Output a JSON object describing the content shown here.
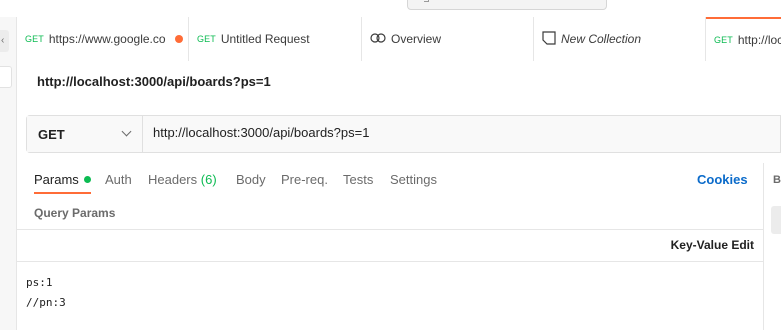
{
  "tabs": [
    {
      "method": "GET",
      "label": "https://www.google.co",
      "unsaved": true
    },
    {
      "method": "GET",
      "label": "Untitled Request"
    },
    {
      "icon": "overview-icon",
      "label": "Overview"
    },
    {
      "icon": "collection-icon",
      "label": "New Collection"
    },
    {
      "method": "GET",
      "label": "http://loc"
    }
  ],
  "request": {
    "title": "http://localhost:3000/api/boards?ps=1",
    "method": "GET",
    "url": "http://localhost:3000/api/boards?ps=1"
  },
  "request_tabs": {
    "params": "Params",
    "auth": "Auth",
    "headers": "Headers",
    "headers_count": "(6)",
    "body": "Body",
    "prereq": "Pre-req.",
    "tests": "Tests",
    "settings": "Settings",
    "cookies": "Cookies"
  },
  "params": {
    "section_label": "Query Params",
    "mode_toggle": "Key-Value Edit",
    "bulk_lines": [
      "ps:1",
      "//pn:3"
    ]
  },
  "right_panel": {
    "letter": "B"
  },
  "colors": {
    "accent": "#ff6c37",
    "get": "#0cbb52",
    "link": "#0b6bca"
  }
}
